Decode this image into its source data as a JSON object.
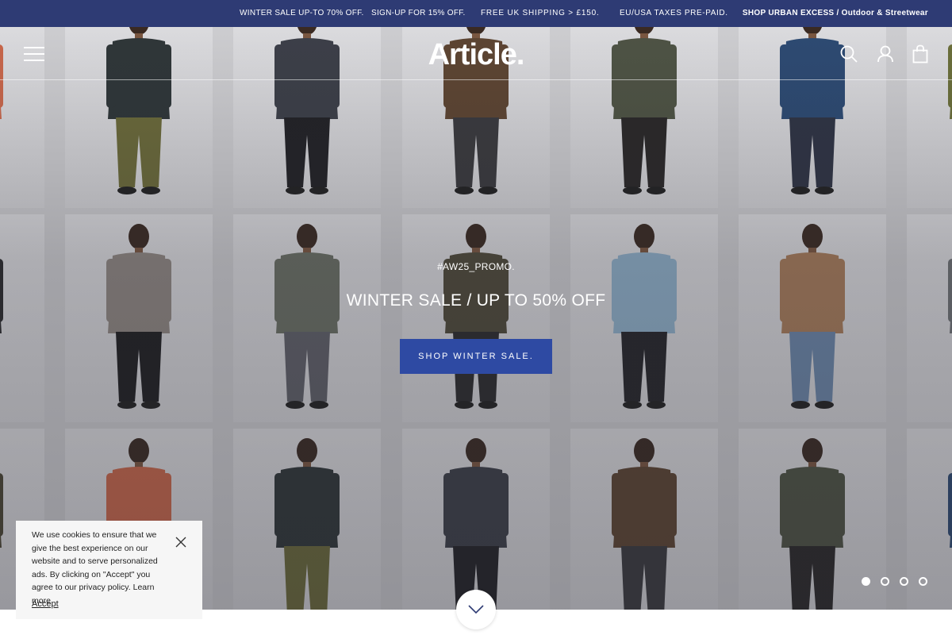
{
  "announcement": {
    "items": [
      "WINTER SALE UP-TO 70% OFF.",
      "SIGN-UP FOR 15% OFF.",
      "FREE UK SHIPPING > £150.",
      "EU/USA TAXES PRE-PAID.",
      "SHOP URBAN EXCESS / Outdoor & Streetwear"
    ]
  },
  "header": {
    "logo": "Article."
  },
  "icons": {
    "menu": "hamburger-icon",
    "search": "search-icon",
    "account": "account-icon",
    "cart": "shopping-bag-icon",
    "scroll": "chevron-down-icon",
    "close": "close-icon"
  },
  "hero": {
    "tag": "#AW25_PROMO.",
    "title": "WINTER SALE / UP TO 50% OFF",
    "cta": "SHOP WINTER SALE.",
    "slide_count": 4,
    "active_slide": 1
  },
  "cookie": {
    "text": "We use cookies to ensure that we give the best experience on our website and to serve personalized ads. By clicking on \"Accept\" you agree to our privacy policy.",
    "learn_more": "Learn more",
    "accept": "Accept"
  },
  "colors": {
    "brand_navy": "#2e3b74",
    "cta_blue": "#2e4aa3"
  }
}
